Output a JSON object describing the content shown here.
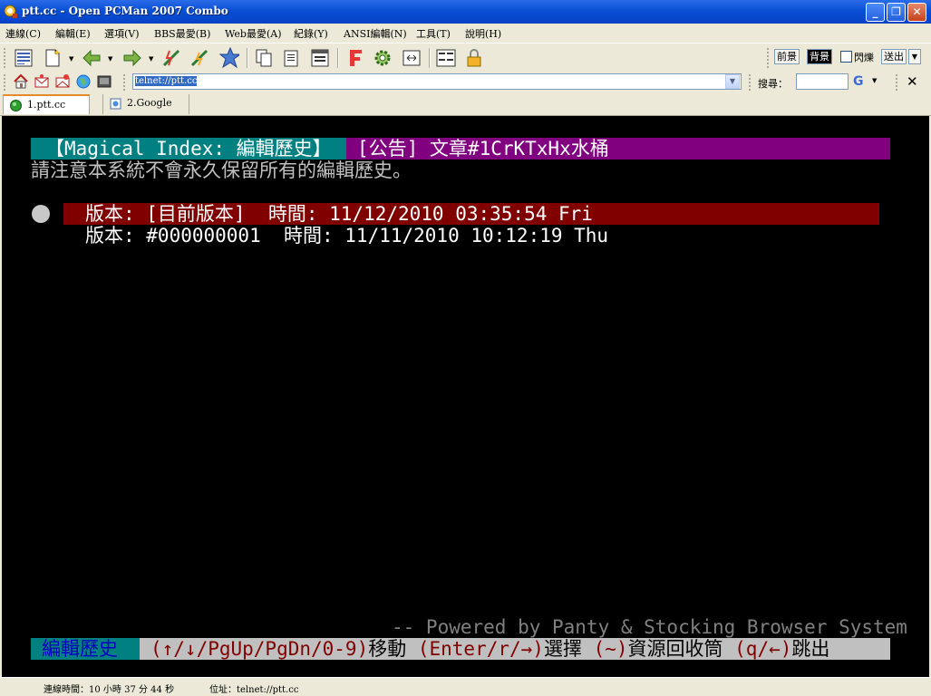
{
  "window": {
    "title": "ptt.cc - Open PCMan 2007 Combo",
    "min_glyph": "_",
    "max_glyph": "❐",
    "close_glyph": "✕"
  },
  "menu": [
    "連線(C)",
    "編輯(E)",
    "選項(V)",
    "BBS最愛(B)",
    "Web最愛(A)",
    "紀錄(Y)",
    "ANSI編輯(N)",
    "工具(T)",
    "說明(H)"
  ],
  "toolbar": {
    "buttons": [
      "site-list-icon",
      "new-connection-icon",
      "back-icon",
      "forward-icon",
      "disconnect-icon",
      "reconnect-icon",
      "add-favorite-icon",
      "copy-icon",
      "paste-icon",
      "copy-with-color-icon",
      "font-icon",
      "settings-icon",
      "fullscreen-icon",
      "ansi-code-icon",
      "lock-icon"
    ],
    "foreground_label": "前景",
    "background_label": "背景",
    "blink_label": "閃爍",
    "send_label": "送出"
  },
  "addressbar": {
    "address": "telnet://ptt.cc",
    "search_label": "搜尋：",
    "search_value": "",
    "search_engine": "G"
  },
  "tabs": [
    {
      "label": "1.ptt.cc",
      "active": true
    },
    {
      "label": "2.Google",
      "active": false
    }
  ],
  "terminal": {
    "header_left": "【Magical Index: 編輯歷史】",
    "header_right": "[公告] 文章#1CrKTxHx水桶",
    "notice": "請注意本系統不會永久保留所有的編輯歷史。",
    "versions": [
      "版本: [目前版本]  時間: 11/12/2010 03:35:54 Fri",
      "版本: #000000001  時間: 11/11/2010 10:12:19 Thu"
    ],
    "powered": "-- Powered by Panty & Stocking Browser System",
    "footer_title": "編輯歷史",
    "footer_keys": [
      {
        "key": "(↑/↓/PgUp/PgDn/0-9)",
        "desc": "移動"
      },
      {
        "key": " (Enter/r/→)",
        "desc": "選擇"
      },
      {
        "key": " (~)",
        "desc": "資源回收筒"
      },
      {
        "key": " (q/←)",
        "desc": "跳出"
      }
    ]
  },
  "status": {
    "connection_time": "連線時間：10 小時 37 分 44 秒",
    "address": "位址：telnet://ptt.cc"
  },
  "colors": {
    "title_bar": "#0A4FD4",
    "terminal_bg": "#000000",
    "header_cyan": "#008080",
    "header_magenta": "#800080",
    "selection_red": "#800000",
    "footer_gray": "#C0C0C0"
  }
}
